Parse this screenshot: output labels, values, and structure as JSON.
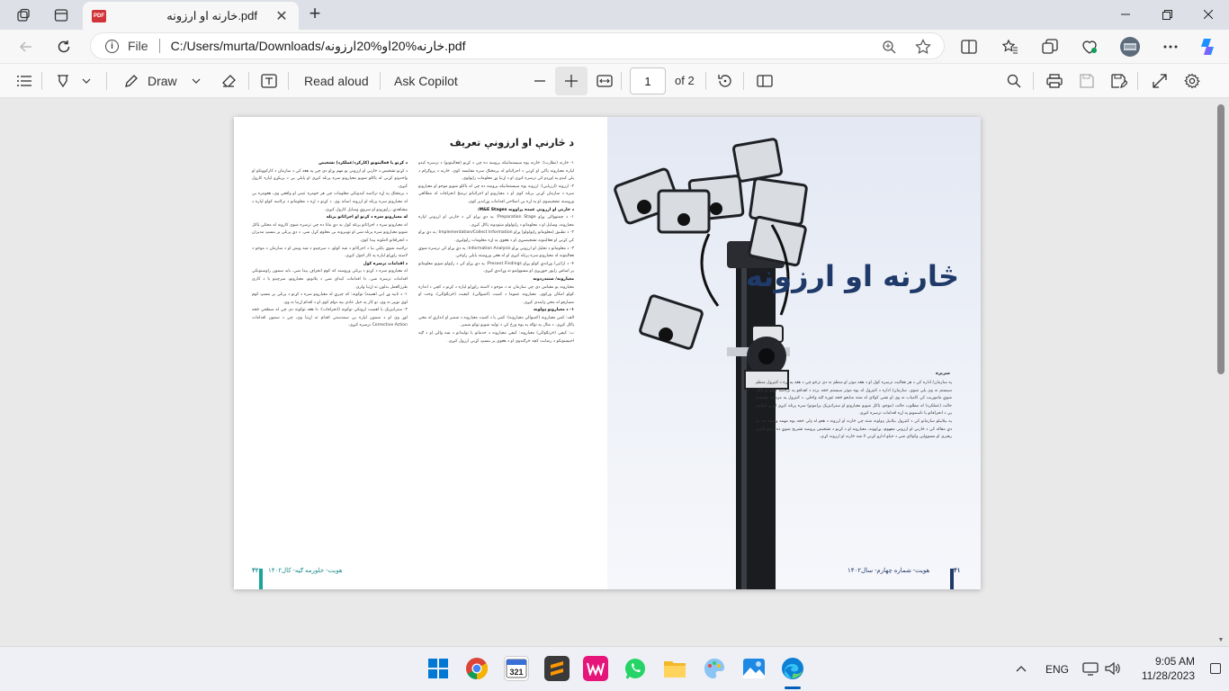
{
  "browser": {
    "tab": {
      "title": "خارنه او ارزونه.pdf",
      "icon": "pdf-icon",
      "close": "✕"
    },
    "new_tab": "+",
    "address": {
      "file_label": "File",
      "url": "C:/Users/murta/Downloads/خارنه%20او%20ارزونه.pdf"
    }
  },
  "pdf_toolbar": {
    "draw_label": "Draw",
    "read_aloud_label": "Read aloud",
    "ask_copilot_label": "Ask Copilot",
    "page_current": "1",
    "page_total": "of 2"
  },
  "document": {
    "article_title": "د څارنې او ارزونې تعریف",
    "col1_paragraphs": [
      "۱- څارنه (نظارت): څارنه یوه سیستماتیکه پروسه ده چې د کړنو (فعالیتونو) د ترسره کېدو لپاره معیارونه ټاکي او کړنې د اجرائیاتو له پرمختګ سره مقایسه کوي. څارنه د پروګرام د پلي کېدو په اوږدو کې ترسره کېږي او د اړتیا وړ معلومات راټولوي.",
      "۲- ارزونه (ارزیابي): ارزونه یوه سیستماتیکه پروسه ده چې له ټاکلو شویو موخو او معیارونو سره د سازمان کړنې پرتله کوي او د معیارونو او اجرائیاتو ترمنځ انحرافات له مطالعې وروسته تشخیصوي او په اړه یې اصلاحي اقدامات وړاندیز کوي.",
      "د څارنې او ارزونې عمده پړاوونه M&E Stages:",
      "۱- د چمتووالي پړاو Preparation Stage: په دې پړاو کې د څارنې او ارزونې لپاره معیارونه، وسایل او د معلوماتو د راټولولو میتودونه ټاکل کېږي.",
      "۲- د تطبیق (معلوماتو راټولولو) پړاو Implementation/Collect Information: په دې پړاو کې کړنې او فعالیتونه تشخیصیږي او د هغوی په اړه معلومات راټولیږي.",
      "۳- د معلوماتو د تحلیل او ارزونې پړاو Information Analysis: په دې پړاو کې ترسره شوې فعالیتونه له معیارونو سره پرتله کېږي او له هغې وروسته پایلې راوځي.",
      "۴- د ارائیې/ وړاندې کولو پړاو Present Findings: په دې پړاو کې د راټولو شویو معلوماتو پر اساس راپور جوړیږي او مسوولینو ته وړاندې کېږي.",
      "معیارونه/ ستندردونه",
      "معیارونه یو مقیاس دی چې سازمان ته د موخو د لاسته راوړلو لپاره د کړنو د کچې د اندازه کولو امکان ورکوي. معیارونه عموما د کمیت (کمیوالي)، کیفیت (څرنګوالي)، وخت او مصارفو له مخې ډلبندي کېږي.",
      "۱- د معیارونو ډولونه",
      "الف: کمي معیارونه (کمیوالي معیارونه): کمي یا د کمیت معیارونه د شمېر او اندازې له مخې ټاکل کېږي. د مثال په توګه په یوه ورځ کې د تولید شویو توکو شمېر.",
      "ب: کیفي (څرنګوالي) معیارونه: کیفي معیارونه د خدماتو یا تولیداتو د ښه والي او د ګټه اخیستونکو د رضایت کچه څرګندوي او د هغوی پر بنسټ کړنې ارزول کېږي."
    ],
    "col2_paragraphs": [
      "د کړنو یا فعالیتونو (کارکرد/عملکرد) تشخیص",
      "د کړنو تشخیص د څارنې او ارزونې یو مهم پړاو دی چې په هغه کې د سازمان د کارکوونکو او واحدونو کړنې له ټاکلو شویو معیارونو سره پرتله کېږي او پایلې یې د پرېکړو لپاره کارول کېږي.",
      "د پرمختګ په اړه ترلاسه کېدونکي معلومات چې هر څومره عیني او واقعي وي، هغومره یې له معیارونو سره پرتله او ارزونه اسانه وي. د کړنو د اړه د معلوماتو د ترلاسه کولو لپاره د مشاهدې، راپورونو او سروې وسایل کارول کېږي.",
      "له معیارونو سره د کړنو او اجرائاتو پرتله",
      "له معیارونو سره د اجرائاتو پرتله کول په دې مانا ده چې ترسره شوي کارونه له مخکې ټاکل شویو معیارونو سره پرتله شي او توپیرونه یې معلوم کړل شي. د دې پرتلې پر بنسټ مدیران د انحرافاتو لاملونه پیدا کوي.",
      "ترلاسه شوې پایلې بیا د اجرائاتو د ښه کولو، د سرچینو د ښه ویش او د سازمان د موخو د لاسته راوړلو لپاره په کار اچول کېږي.",
      "د اقدامات ترسره کول",
      "له معیارونو سره د کړنو د پرتلې وروسته که کوم انحراف پیدا شي، باید سمون راوستونکي اقدامات ترسره شي. دا اقدامات کېدای شي د پلانونو، معیارونو، سرچینو یا د کاري طرزالعمل بدلون ته اړتیا ولري.",
      "۱- د تایید وړ (بې اهمیته) توکونه: که چېرې له معیارونو سره د کړنو د پرتلې پر بنسټ کوم لوی توپیر نه وي، نو کار په خپل عادي بڼه دوام کوي او د اقدام اړتیا نه وي.",
      "۲- ستراتیژیک یا اهمیت لرونکي توکونه (انحرافات): دا هغه توکونه دي چې له سطحې څخه لوړ وي او د سمون لپاره یې سمدستي اقدام ته اړتیا وي، چې د سمون اقدامات Corrective Action ترسره کېږي."
    ],
    "footer_left": {
      "text": "هویت- خلورمه ګڼه- کال۱۴۰۲",
      "page": "۴۲"
    },
    "hero_title": "څارنه او ارزونه",
    "hero_subtitle": "سریزه",
    "col3_paragraphs": [
      "په سازمان/ اداره کې د هر فعالیت ترسره کول او د هغه موثر او منظم نه دي ترڅو چې د هغه په اړه د کنټرول منظم سیستم نه وي پلي شوی. سازمان/ اداره د کنټرول له یوه موثر سیستم څخه برته د اهدافو په ترلاسه کولو او ټاکل شوې ماموریت کې کامیاب نه وي او نشي کولای له شته منابعو څخه غوره ګټه واخلي. د کنټرول په مرسته موجوده حالت (عملکرد) له مطلوب حالت (موخو، ټاکل شویو معیارونو او ستراتیژیک پرامونو) سره پرتله کېږي او پر اساس یې د انحرافاتو یا ناسمونو په اړه اقدامات ترسره کېږي.",
      "په بیلابیلو سازمانو کې د کنټرول بېلابېل ډولونه شته چې څارنه او ارزونه د هغو له ډلې څخه یوه مهمه وسیله ده. په دې مقاله کې د څارنې او ارزونې مفهوم، پړاوونه، معیارونه او د کړنو د تشخیص پروسه تشریح شوې ده ترڅو اداري رهبري او مسوولین وکولای شي د خپلو ادارو کړنې لا ښه څارنه او ارزونه کړي."
    ],
    "footer_right": {
      "text": "هویت- شماره چهارم- سال۱۴۰۲",
      "page": "۴۱"
    }
  },
  "taskbar": {
    "apps": [
      "windows-start",
      "chrome",
      "calendar",
      "sublime-text",
      "wampserver",
      "whatsapp",
      "file-explorer",
      "paint",
      "photos",
      "edge"
    ],
    "language": "ENG",
    "time": "9:05 AM",
    "date": "11/28/2023"
  }
}
